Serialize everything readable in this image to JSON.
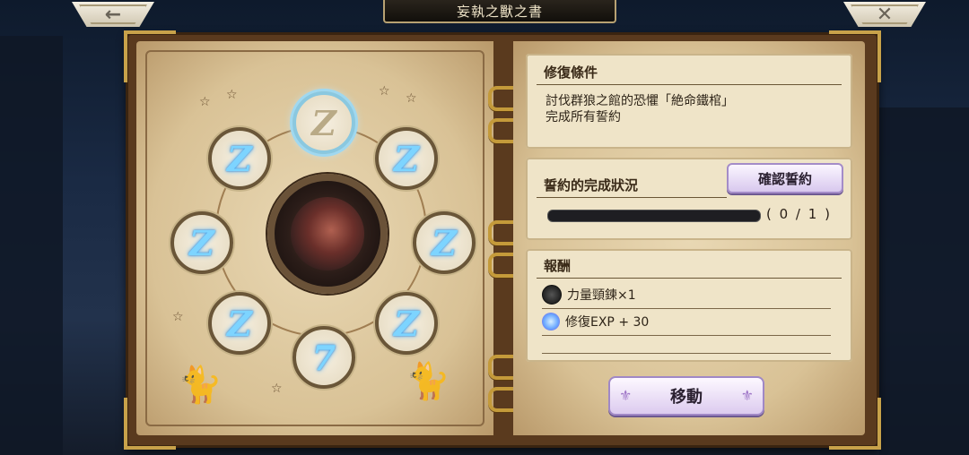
{
  "header": {
    "back_icon": "←",
    "close_icon": "✕",
    "title": "妄執之獸之書"
  },
  "seals": {
    "top": "Z",
    "upper_left": "Z",
    "upper_right": "Z",
    "mid_left": "Z",
    "mid_right": "Z",
    "lower_left": "Z",
    "lower_right": "Z",
    "bottom": "7"
  },
  "conditions": {
    "title": "修復條件",
    "line1": "討伐群狼之館的恐懼「絶命鐵棺」",
    "line2": "完成所有誓約"
  },
  "oath": {
    "title": "誓約的完成狀況",
    "confirm_label": "確認誓約",
    "progress": 0,
    "count_text": "( 0 / 1 )"
  },
  "rewards": {
    "title": "報酬",
    "items": [
      {
        "label": "力量頸鍊×1",
        "icon": "necklace-icon"
      },
      {
        "label": "修復EXP + 30",
        "icon": "exp-flame-icon"
      }
    ]
  },
  "actions": {
    "move_label": "移動"
  },
  "colors": {
    "seal_glow": "#7dd4ff",
    "button_purple": "#dccbef",
    "page": "#e9d8b4"
  }
}
